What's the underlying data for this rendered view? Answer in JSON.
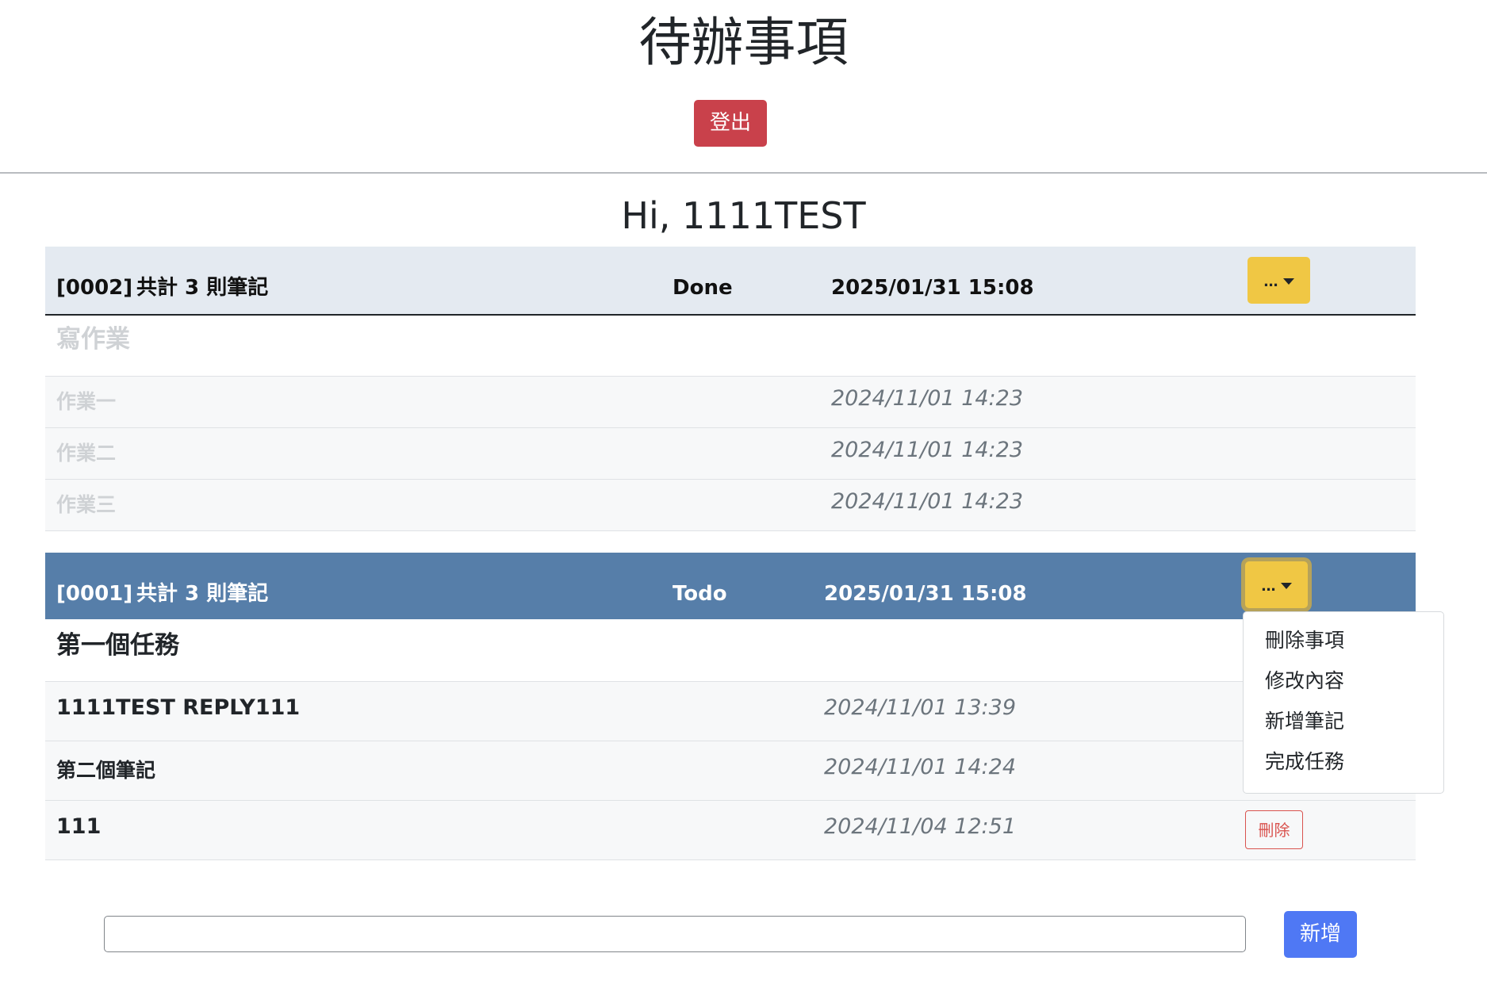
{
  "header": {
    "title": "待辦事項",
    "logout_label": "登出"
  },
  "greeting": "Hi, 1111TEST",
  "tasks": [
    {
      "id": "[0002]",
      "note_count": "共計 3 則筆記",
      "status": "Done",
      "datetime": "2025/01/31 15:08",
      "menu_toggle": "...",
      "title": "寫作業",
      "notes": [
        {
          "text": "作業一",
          "time": "2024/11/01 14:23"
        },
        {
          "text": "作業二",
          "time": "2024/11/01 14:23"
        },
        {
          "text": "作業三",
          "time": "2024/11/01 14:23"
        }
      ]
    },
    {
      "id": "[0001]",
      "note_count": "共計 3 則筆記",
      "status": "Todo",
      "datetime": "2025/01/31 15:08",
      "menu_toggle": "...",
      "title": "第一個任務",
      "notes": [
        {
          "text": "1111TEST REPLY111",
          "time": "2024/11/01 13:39"
        },
        {
          "text": "第二個筆記",
          "time": "2024/11/01 14:24"
        },
        {
          "text": "111",
          "time": "2024/11/04 12:51",
          "delete_label": "刪除"
        }
      ]
    }
  ],
  "dropdown_menu": {
    "items": [
      "刪除事項",
      "修改內容",
      "新增筆記",
      "完成任務"
    ]
  },
  "add_form": {
    "input_value": "",
    "placeholder": "",
    "button_label": "新增"
  },
  "colors": {
    "logout": "#c9414b",
    "done_header": "#e4eaf1",
    "todo_header": "#567ea9",
    "menu_toggle": "#f0c744",
    "add_button": "#4f78f4",
    "delete_outline": "#d9534f"
  }
}
